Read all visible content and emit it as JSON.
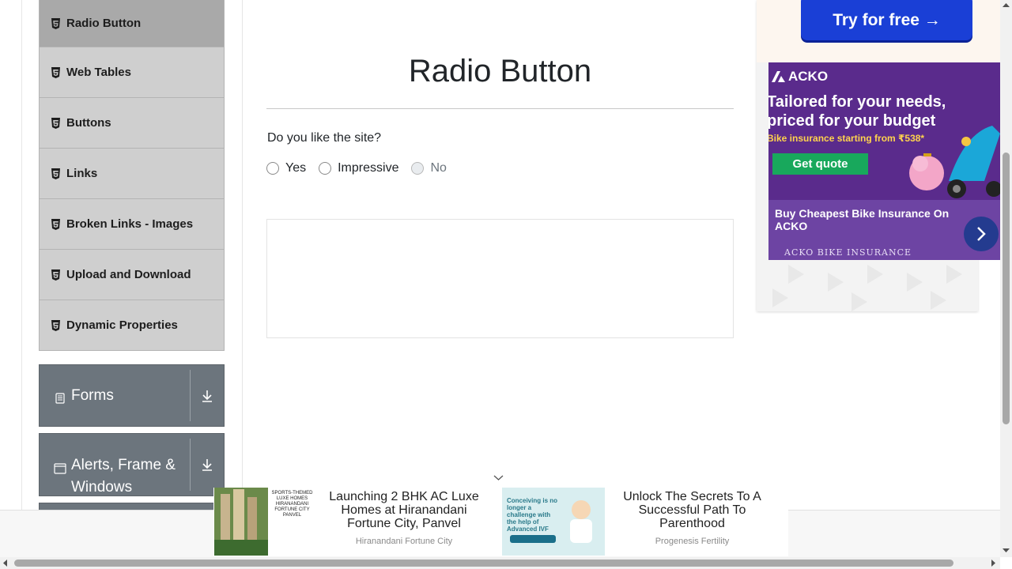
{
  "sidebar": {
    "items": [
      {
        "label": "Radio Button",
        "active": true
      },
      {
        "label": "Web Tables"
      },
      {
        "label": "Buttons"
      },
      {
        "label": "Links"
      },
      {
        "label": "Broken Links - Images"
      },
      {
        "label": "Upload and Download"
      },
      {
        "label": "Dynamic Properties"
      }
    ],
    "groups": {
      "forms": "Forms",
      "alerts": "Alerts, Frame & Windows"
    }
  },
  "main": {
    "title": "Radio Button",
    "question": "Do you like the site?",
    "options": [
      {
        "label": "Yes",
        "disabled": false
      },
      {
        "label": "Impressive",
        "disabled": false
      },
      {
        "label": "No",
        "disabled": true
      }
    ]
  },
  "right_ad": {
    "try_button": "Try for free →",
    "brand": "ACKO",
    "headline_1": "Tailored for your needs,",
    "headline_2": "priced for your budget",
    "sub": "Bike insurance starting from ₹538*",
    "cta": "Get quote",
    "caption": "Buy Cheapest Bike Insurance On ACKO",
    "footer": "ACKO BIKE INSURANCE"
  },
  "bottom_ad": {
    "ad1_title": "Launching 2 BHK AC Luxe Homes at Hiranandani Fortune City, Panvel",
    "ad1_source": "Hiranandani Fortune City",
    "ad1_card_text": "SPORTS-THEMED LUXE HOMES HIRANANDANI FORTUNE CITY PANVEL",
    "ad2_title": "Unlock The Secrets To A Successful Path To Parenthood",
    "ad2_source": "Progenesis Fertility",
    "ad2_card_text": "Conceiving is no longer a challenge with the help of Advanced IVF"
  },
  "colors": {
    "sidebar_item": "#cfcfcf",
    "sidebar_active": "#a9a9a9",
    "group_bg": "#6c757d",
    "try_button": "#1a3fd6",
    "acko_purple": "#5a2b8c",
    "acko_cta": "#18a85c"
  }
}
